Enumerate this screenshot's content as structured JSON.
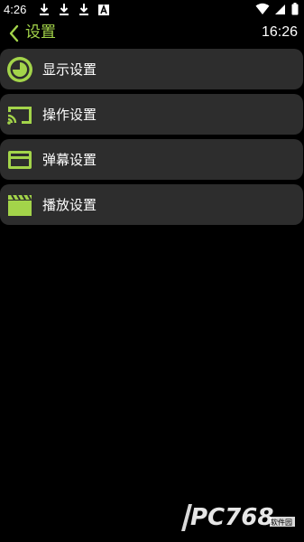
{
  "status_bar": {
    "time": "4:26",
    "left_icons": [
      "download-icon",
      "download-icon",
      "download-icon",
      "app-a-icon"
    ],
    "right_icons": [
      "wifi-icon",
      "signal-icon",
      "battery-icon"
    ]
  },
  "header": {
    "back_icon": "chevron-left-icon",
    "title": "设置",
    "clock": "16:26",
    "accent_color": "#a3d44a"
  },
  "menu": {
    "items": [
      {
        "label": "显示设置",
        "icon": "display-icon"
      },
      {
        "label": "操作设置",
        "icon": "cast-icon"
      },
      {
        "label": "弹幕设置",
        "icon": "card-icon"
      },
      {
        "label": "播放设置",
        "icon": "clapperboard-icon"
      }
    ]
  },
  "watermark": {
    "text": "PC768",
    "sub_text": "软件园"
  }
}
